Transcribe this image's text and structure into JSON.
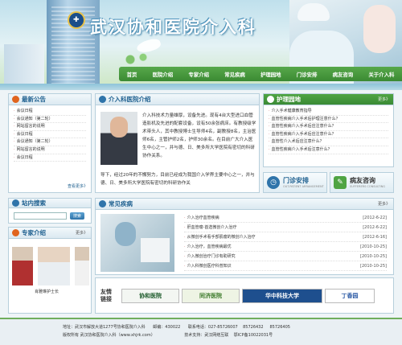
{
  "header": {
    "title": "武汉协和医院介入科",
    "logo_mark": "✚"
  },
  "nav": {
    "items": [
      "首页",
      "医院介绍",
      "专家介绍",
      "常见疾病",
      "护理园地",
      "门诊安排",
      "病友咨询",
      "关于介入科"
    ]
  },
  "notice": {
    "title": "最新公告",
    "more": "查看更多》",
    "items": [
      "会议日程",
      "会议通知（第二轮）",
      "网站留言的说明",
      "会议日程",
      "会议通知（第二轮）",
      "网站留言的说明",
      "会议日程"
    ]
  },
  "intro": {
    "title": "介入科医院介绍",
    "text": "介入科技术力量雄厚，设备先进。现有4台大型进口血管造影机及先进的配套设备，设有50余张病床。有教授级学术带头人，其中教授博士生导师4名，副教授8名，主治医师6名，主管护师2名，护师30余名。在目前广大介入医生中心之一，并与德、日、美多所大学医院有密切的科研协作关系。",
    "text_b": "导下，经过20年的不懈努力，目前已经成为我国介入学界主要中心之一，并与德、日、美多所大学医院有密切的科研协作关"
  },
  "nursing": {
    "title": "护理园地",
    "more": "更多》",
    "items": [
      "介入手术健康教育指导",
      "血管性疾病介入手术后护理注意什么？",
      "血管性疾病介入手术后应注意什么？",
      "血管性疾病介入手术后应注意什么？",
      "血管性介入术后应注意什么？",
      "血管性疾病介入手术后注意什么？"
    ]
  },
  "clinic_btn": {
    "label": "门诊安排",
    "sub": "OUT-PATIENT ARRANGEMENT"
  },
  "consult_btn": {
    "label": "病友咨询",
    "sub": "SUFFERERS CONSULTING"
  },
  "search": {
    "title": "站内搜索",
    "button": "搜索"
  },
  "diseases": {
    "title": "常见疾病",
    "more": "更多》",
    "items": [
      {
        "text": "介入治疗血管疾病",
        "date": "[2012-6-22]"
      },
      {
        "text": "肝血管瘤-首选微创介入治疗",
        "date": "[2012-6-22]"
      },
      {
        "text": "从微创手术看手部肌瘤的微创介入治疗",
        "date": "[2012-6-16]"
      },
      {
        "text": "介入治疗，血管疾病最优",
        "date": "[2010-10-25]"
      },
      {
        "text": "介入微创治疗门诊有助研究",
        "date": "[2010-10-25]"
      },
      {
        "text": "介入科微创医疗科普知识",
        "date": "[2010-10-25]"
      }
    ]
  },
  "experts": {
    "title": "专家介绍",
    "more": "更多》",
    "names": [
      "",
      "肖雅琳护士长",
      ""
    ]
  },
  "links": {
    "title": "友情链接",
    "items": [
      "协和医院",
      "同济医院",
      "华中科技大学",
      "丁香园"
    ]
  },
  "footer": {
    "line1": "地址：武汉市解放大道1277号协和医院介入科",
    "zip": "邮编：430022",
    "phone": "联系电话：027-85726007",
    "p2": "85726432",
    "p3": "85726405",
    "line2": "版权所有 武汉协和医院介入科（www.xhjrk.com）",
    "tech": "技术支持：武汉网络互联",
    "icp": "鄂ICP备10022031号"
  }
}
